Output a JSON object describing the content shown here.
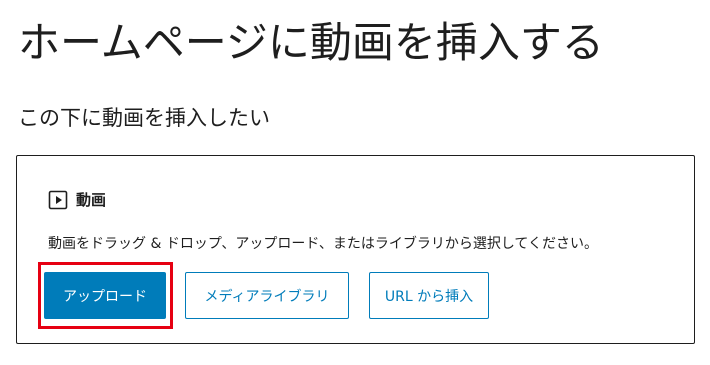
{
  "page": {
    "title": "ホームページに動画を挿入する",
    "paragraph": "この下に動画を挿入したい"
  },
  "video_block": {
    "icon": "video-icon",
    "label": "動画",
    "instructions": "動画をドラッグ & ドロップ、アップロード、またはライブラリから選択してください。",
    "buttons": {
      "upload": "アップロード",
      "media_library": "メディアライブラリ",
      "insert_from_url": "URL から挿入"
    }
  },
  "colors": {
    "accent": "#007cba",
    "highlight": "#e60012",
    "text": "#1e1e1e"
  }
}
